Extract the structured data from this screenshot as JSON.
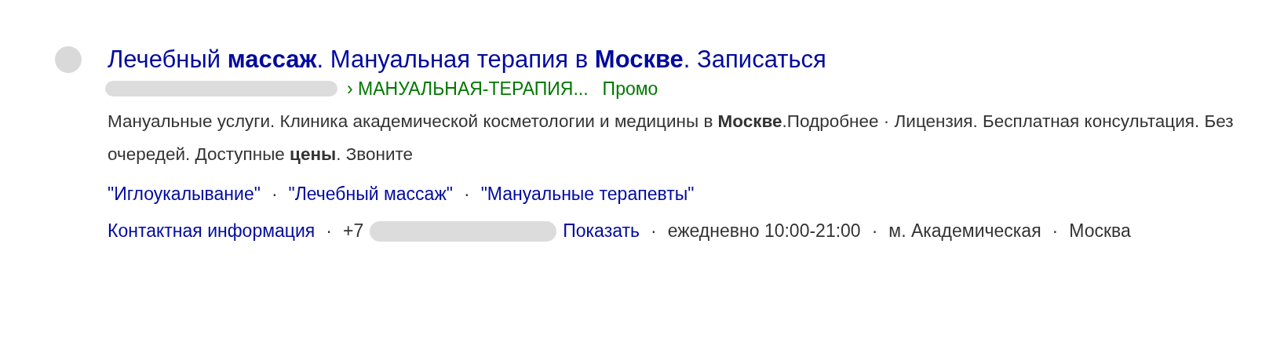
{
  "result": {
    "title": "Лечебный **массаж**. Мануальная терапия в **Москве**. Записаться",
    "url": [
      {
        "kind": "redacted"
      },
      {
        "kind": "path",
        "text": "› МАНУАЛЬНАЯ-ТЕРАПИЯ..."
      },
      {
        "kind": "label",
        "text": "Промо"
      }
    ],
    "description": "Мануальные услуги. Клиника академической косметологии и медицины в **Москве**.Подробнее · Лицензия. Бесплатная консультация. Без очередей. Доступные **цены**. Звоните",
    "sitelinks": [
      {
        "kind": "link",
        "text": "\"Иглоукалывание\""
      },
      {
        "kind": "sep",
        "text": "·"
      },
      {
        "kind": "link",
        "text": "\"Лечебный массаж\""
      },
      {
        "kind": "sep",
        "text": "·"
      },
      {
        "kind": "link",
        "text": "\"Мануальные терапевты\""
      }
    ],
    "contacts": [
      {
        "kind": "link",
        "text": "Контактная информация"
      },
      {
        "kind": "sep",
        "text": "·"
      },
      {
        "kind": "text",
        "text": "+7"
      },
      {
        "kind": "redacted"
      },
      {
        "kind": "link",
        "text": "Показать"
      },
      {
        "kind": "sep",
        "text": "·"
      },
      {
        "kind": "text",
        "text": "ежедневно 10:00-21:00"
      },
      {
        "kind": "sep",
        "text": "·"
      },
      {
        "kind": "text",
        "text": "м. Академическая"
      },
      {
        "kind": "sep",
        "text": "·"
      },
      {
        "kind": "text",
        "text": "Москва"
      }
    ]
  }
}
